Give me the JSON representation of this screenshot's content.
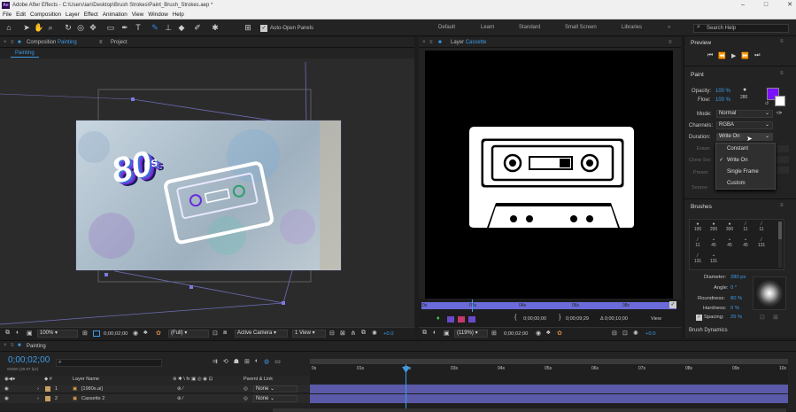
{
  "window": {
    "title": "Adobe After Effects - C:\\Users\\ian\\Desktop\\Brush Strokes\\Paint_Brush_Strokes.aep *",
    "logo_text": "Ae"
  },
  "menu": [
    "File",
    "Edit",
    "Composition",
    "Layer",
    "Effect",
    "Animation",
    "View",
    "Window",
    "Help"
  ],
  "toolbar": {
    "auto_open_label": "Auto-Open Panels",
    "workspaces": [
      "Default",
      "Learn",
      "Standard",
      "Small Screen",
      "Libraries"
    ],
    "search_placeholder": "Search Help"
  },
  "composition_panel": {
    "tab_prefix": "Composition",
    "tab_name": "Painting",
    "project_tab": "Project",
    "sub_tab": "Painting",
    "zoom": "100%",
    "timecode": "0;00;02;00",
    "resolution": "(Full)",
    "camera": "Active Camera",
    "views": "1 View",
    "exposure": "+0.0"
  },
  "layer_panel": {
    "tab_prefix": "Layer",
    "tab_name": "Cassette",
    "ruler": [
      "0s",
      "02s",
      "04s",
      "06s",
      "08s"
    ],
    "zoom": "(119%)",
    "timecode": "0;00;02;00",
    "start_time": "0;00;00;00",
    "end_time": "0;00;09;29",
    "duration": "Δ 0;00;10;00",
    "view_label": "View",
    "exposure": "+0.0"
  },
  "preview": {
    "title": "Preview"
  },
  "paint": {
    "title": "Paint",
    "opacity_label": "Opacity:",
    "opacity_value": "100 %",
    "flow_label": "Flow:",
    "flow_value": "100 %",
    "brush_size": "280",
    "mode_label": "Mode:",
    "mode_value": "Normal",
    "channels_label": "Channels:",
    "channels_value": "RGBA",
    "duration_label": "Duration:",
    "duration_value": "Write On",
    "duration_options": [
      "Constant",
      "Write On",
      "Single Frame",
      "Custom"
    ],
    "selected_option": "Write On",
    "foreground_color": "#7a12ff",
    "background_color": "#ffffff",
    "faded_labels": [
      "Erase:",
      "Clone Src:",
      "Preset:",
      "Source:"
    ]
  },
  "brushes": {
    "title": "Brushes",
    "sizes_row1": [
      "100",
      "200",
      "300",
      "11",
      "11"
    ],
    "sizes_row2": [
      "11",
      "45",
      "45",
      "45",
      "131"
    ],
    "sizes_row3": [
      "131",
      "131"
    ],
    "diameter_label": "Diameter:",
    "diameter_value": "280 px",
    "angle_label": "Angle:",
    "angle_value": "0 °",
    "roundness_label": "Roundness:",
    "roundness_value": "80 %",
    "hardness_label": "Hardness:",
    "hardness_value": "0 %",
    "spacing_label": "Spacing:",
    "spacing_value": "25 %",
    "dynamics_label": "Brush Dynamics"
  },
  "timeline": {
    "tab": "Painting",
    "current_time": "0;00;02;00",
    "fps_info": "00060 (29.97 fps)",
    "columns": {
      "layer_name": "Layer Name",
      "parent": "Parent & Link"
    },
    "ruler": [
      "0s",
      "01s",
      "02s",
      "03s",
      "04s",
      "05s",
      "06s",
      "07s",
      "08s",
      "09s",
      "10s"
    ],
    "layers": [
      {
        "num": "1",
        "name": "[1980s.ai]",
        "parent": "None"
      },
      {
        "num": "2",
        "name": "Cassette 2",
        "parent": "None"
      }
    ]
  },
  "artwork": {
    "badge_text": "80",
    "badge_suffix": "s"
  }
}
